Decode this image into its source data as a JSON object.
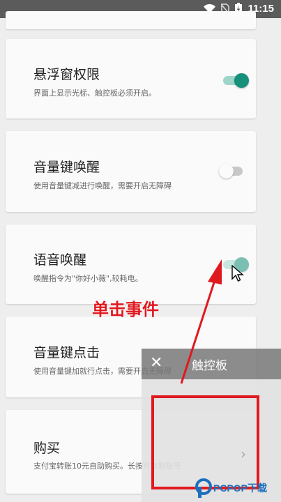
{
  "status_bar": {
    "time": "11:15",
    "icons": [
      "wifi-icon",
      "no-sim-icon",
      "battery-icon"
    ]
  },
  "settings": [
    {
      "title": "悬浮窗权限",
      "description": "界面上显示光标、触控板必须开启。",
      "enabled": true
    },
    {
      "title": "音量键唤醒",
      "description": "使用音量键减进行唤醒，需要开启无障碍",
      "enabled": false
    },
    {
      "title": "语音唤醒",
      "description": "唤醒指令为\"你好小薇\",较耗电。",
      "enabled": true
    },
    {
      "title": "音量键点击",
      "description": "使用音量键加就行点击，需要开启无障碍",
      "enabled": false
    },
    {
      "title": "购买",
      "description": "支付宝转账10元自助购买。长按可复制账号"
    }
  ],
  "touchpad_overlay": {
    "close_symbol": "✕",
    "title": "触控板",
    "chevron": "›"
  },
  "annotation": {
    "label": "单击事件",
    "color": "#e0191f"
  },
  "watermark": {
    "text": "PCPOP下载"
  },
  "colors": {
    "toggle_on": "#15907a",
    "toggle_on_track": "#9ed6c9",
    "status_bar": "#5b5b5b",
    "background": "#eeeeee"
  }
}
